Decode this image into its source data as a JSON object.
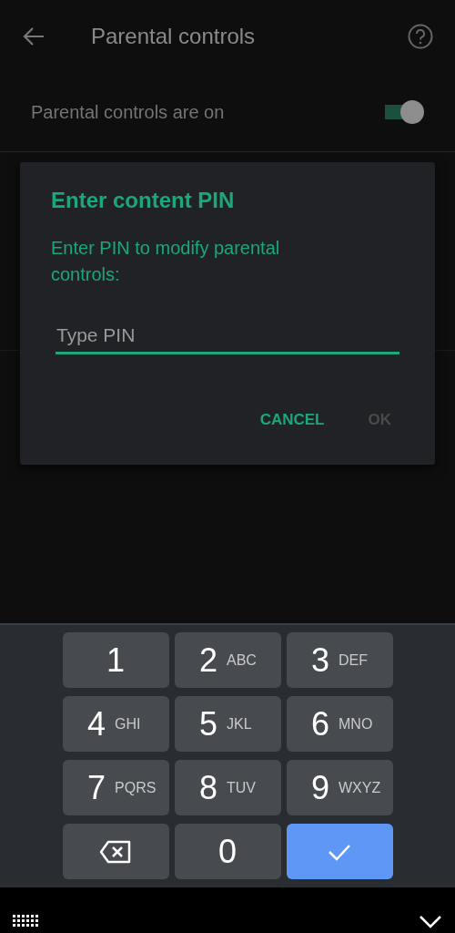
{
  "app_bar": {
    "title": "Parental controls"
  },
  "setting": {
    "label": "Parental controls are on",
    "on": true
  },
  "dialog": {
    "title": "Enter content PIN",
    "message": "Enter PIN to modify parental controls:",
    "pin_field": {
      "placeholder": "Type PIN"
    },
    "buttons": [
      {
        "label": "CANCEL",
        "disabled": false
      },
      {
        "label": "OK",
        "disabled": true
      }
    ]
  },
  "keypad": {
    "keys": [
      {
        "kind": "digit",
        "digit": "1"
      },
      {
        "kind": "digit",
        "digit": "2",
        "letters": "ABC"
      },
      {
        "kind": "digit",
        "digit": "3",
        "letters": "DEF"
      },
      {
        "kind": "digit",
        "digit": "4",
        "letters": "GHI"
      },
      {
        "kind": "digit",
        "digit": "5",
        "letters": "JKL"
      },
      {
        "kind": "digit",
        "digit": "6",
        "letters": "MNO"
      },
      {
        "kind": "digit",
        "digit": "7",
        "letters": "PQRS"
      },
      {
        "kind": "digit",
        "digit": "8",
        "letters": "TUV"
      },
      {
        "kind": "digit",
        "digit": "9",
        "letters": "WXYZ"
      },
      {
        "kind": "backspace"
      },
      {
        "kind": "digit",
        "digit": "0"
      },
      {
        "kind": "enter"
      }
    ]
  }
}
